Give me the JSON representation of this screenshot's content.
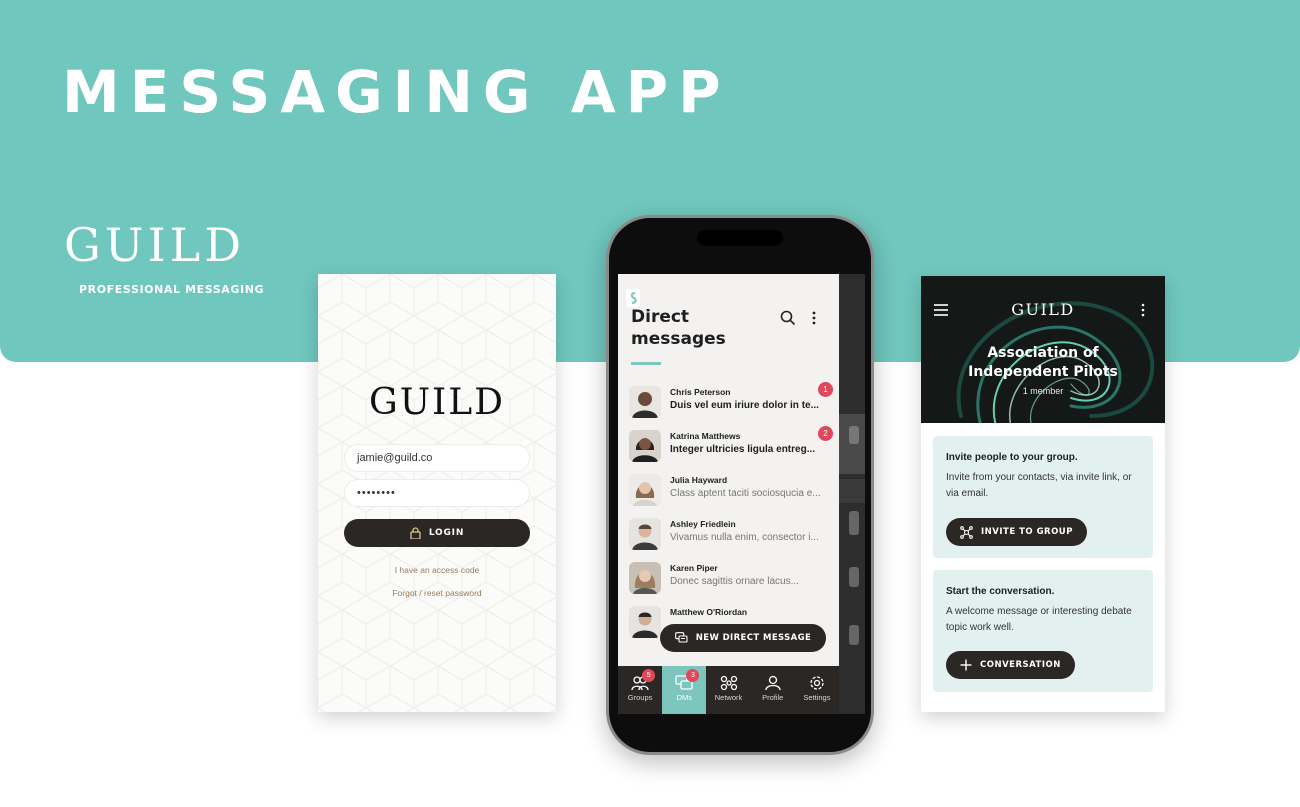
{
  "banner": {
    "headline": "MESSAGING APP",
    "brand_logo": "GUILD",
    "brand_tagline": "PROFESSIONAL MESSAGING",
    "color": "#70c7bd"
  },
  "login": {
    "logo": "GUILD",
    "email_value": "jamie@guild.co",
    "password_value": "••••••••",
    "login_button": "LOGIN",
    "access_code_link": "I have an access code",
    "forgot_link": "Forgot / reset password"
  },
  "dm": {
    "title": "Direct messages",
    "icons": [
      "search-icon",
      "more-vertical-icon"
    ],
    "conversations": [
      {
        "name": "Chris Peterson",
        "preview": "Duis vel eum iriure dolor in te...",
        "unread": true,
        "badge": "1"
      },
      {
        "name": "Katrina Matthews",
        "preview": "Integer ultricies ligula entreg...",
        "unread": true,
        "badge": "2"
      },
      {
        "name": "Julia Hayward",
        "preview": "Class aptent taciti sociosqucia e...",
        "unread": false,
        "badge": ""
      },
      {
        "name": "Ashley Friedlein",
        "preview": "Vivamus nulla enim, consector i...",
        "unread": false,
        "badge": ""
      },
      {
        "name": "Karen Piper",
        "preview": "Donec sagittis ornare lacus...",
        "unread": false,
        "badge": ""
      },
      {
        "name": "Matthew O'Riordan",
        "preview": "",
        "unread": false,
        "badge": ""
      }
    ],
    "new_dm_button": "NEW DIRECT MESSAGE",
    "tabs": [
      {
        "label": "Groups",
        "badge": "5",
        "icon": "groups-icon",
        "active": false
      },
      {
        "label": "DMs",
        "badge": "3",
        "icon": "chat-icon",
        "active": true
      },
      {
        "label": "Network",
        "badge": "",
        "icon": "network-icon",
        "active": false
      },
      {
        "label": "Profile",
        "badge": "",
        "icon": "profile-icon",
        "active": false
      },
      {
        "label": "Settings",
        "badge": "",
        "icon": "gear-icon",
        "active": false
      }
    ]
  },
  "group": {
    "logo": "GUILD",
    "name_line1": "Association of",
    "name_line2": "Independent Pilots",
    "member_count": "1 member",
    "invite_card": {
      "title": "Invite people to your group.",
      "body": "Invite from your contacts, via invite link, or via email.",
      "button": "INVITE TO GROUP"
    },
    "conversation_card": {
      "title": "Start the conversation.",
      "body": "A welcome message or interesting debate topic work well.",
      "button": "CONVERSATION"
    }
  },
  "colors": {
    "accent": "#70c7bd",
    "dark": "#2b2725",
    "badge": "#e0475b",
    "card": "#e2f1ef",
    "link": "#9a7a5a"
  }
}
